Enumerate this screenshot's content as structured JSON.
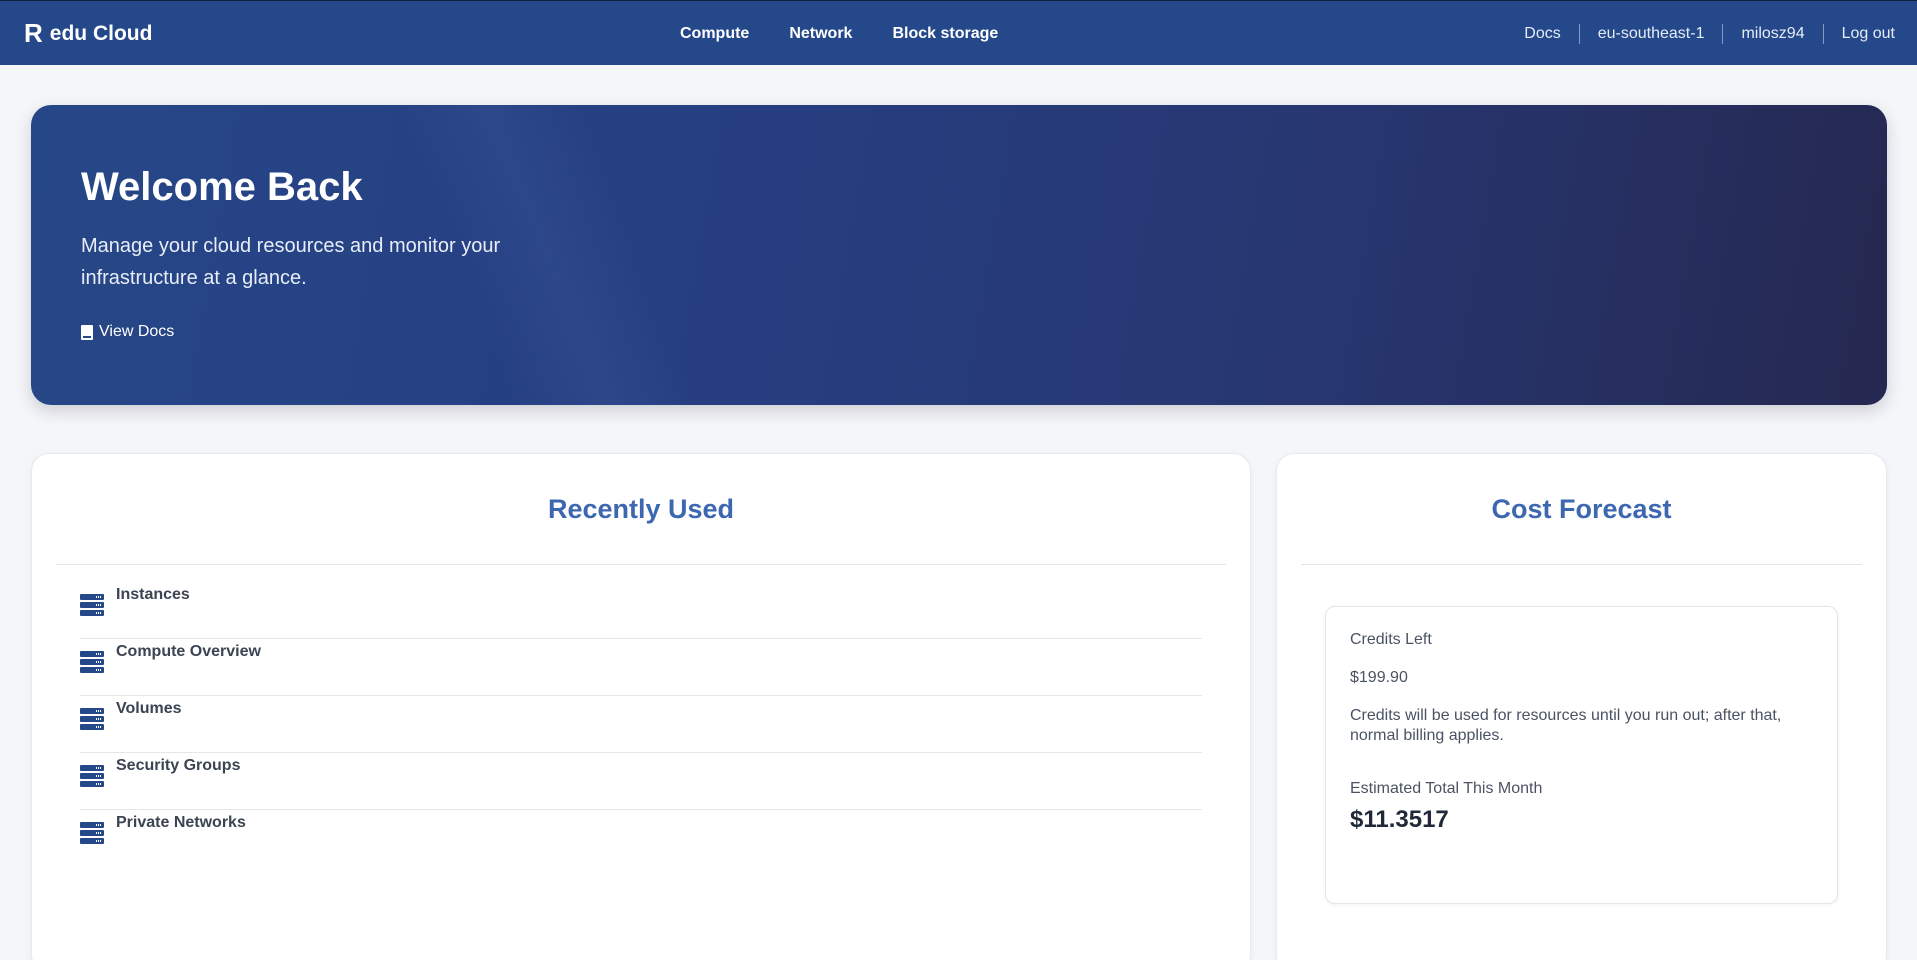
{
  "brand": {
    "logo": "R",
    "name": "edu Cloud"
  },
  "nav": {
    "center": [
      "Compute",
      "Network",
      "Block storage"
    ],
    "right": [
      "Docs",
      "eu-southeast-1",
      "milosz94",
      "Log out"
    ]
  },
  "hero": {
    "title": "Welcome Back",
    "subtitle": "Manage your cloud resources and monitor your infrastructure at a glance.",
    "docs_link": "View Docs",
    "docs_icon": "book-icon"
  },
  "recent": {
    "title": "Recently Used",
    "item_icon": "server-icon",
    "items": [
      "Instances",
      "Compute Overview",
      "Volumes",
      "Security Groups",
      "Private Networks"
    ]
  },
  "cost": {
    "title": "Cost Forecast",
    "credits_label": "Credits Left",
    "credits_value": "$199.90",
    "credits_note": "Credits will be used for resources until you run out; after that, normal billing applies.",
    "estimate_label": "Estimated Total This Month",
    "estimate_value": "$11.3517"
  },
  "colors": {
    "topbar": "#24488a",
    "accent_title": "#3d67b0",
    "background": "#f5f6f9"
  }
}
